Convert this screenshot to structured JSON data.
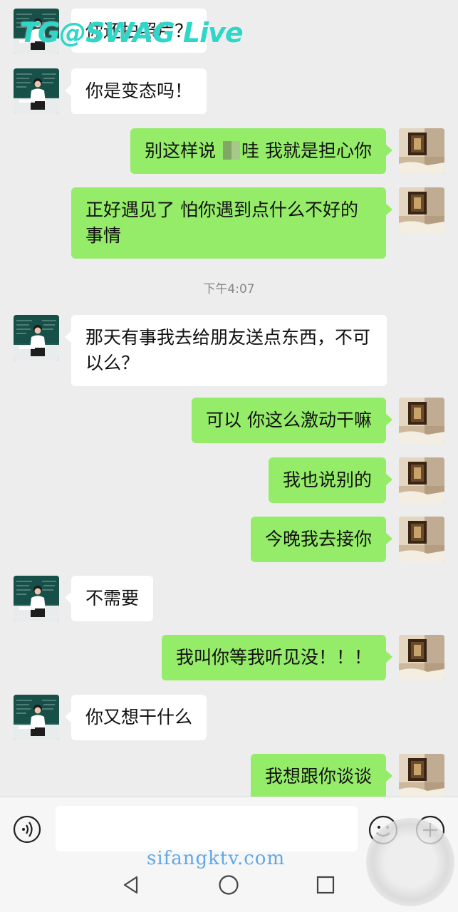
{
  "watermark": "TG@SWAG Live",
  "site_watermark": "sifangktv.com",
  "chat": {
    "partial_top_message": "你还拍照片？",
    "messages": [
      {
        "side": "left",
        "text": "你是变态吗！"
      },
      {
        "side": "right",
        "text_before": "别这样说",
        "text_after": "哇 我就是担心你"
      },
      {
        "side": "right",
        "text": "正好遇见了 怕你遇到点什么不好的事情"
      },
      {
        "side": "time",
        "text": "下午4:07"
      },
      {
        "side": "left",
        "text": "那天有事我去给朋友送点东西，不可以么？"
      },
      {
        "side": "right",
        "text": "可以 你这么激动干嘛"
      },
      {
        "side": "right",
        "text": "我也说别的"
      },
      {
        "side": "right",
        "text": "今晚我去接你"
      },
      {
        "side": "left",
        "text": "不需要"
      },
      {
        "side": "right",
        "text": "我叫你等我听见没！！！"
      },
      {
        "side": "left",
        "text": "你又想干什么"
      },
      {
        "side": "right",
        "text": "我想跟你谈谈"
      }
    ]
  },
  "input_bar": {
    "voice_icon": "voice-icon",
    "emoji_icon": "emoji-icon",
    "plus_icon": "plus-icon",
    "value": ""
  },
  "navbar": {
    "back_icon": "back-triangle-icon",
    "home_icon": "home-circle-icon",
    "recent_icon": "recent-square-icon"
  },
  "colors": {
    "background": "#ededed",
    "own_bubble": "#95ec69",
    "other_bubble": "#ffffff"
  }
}
